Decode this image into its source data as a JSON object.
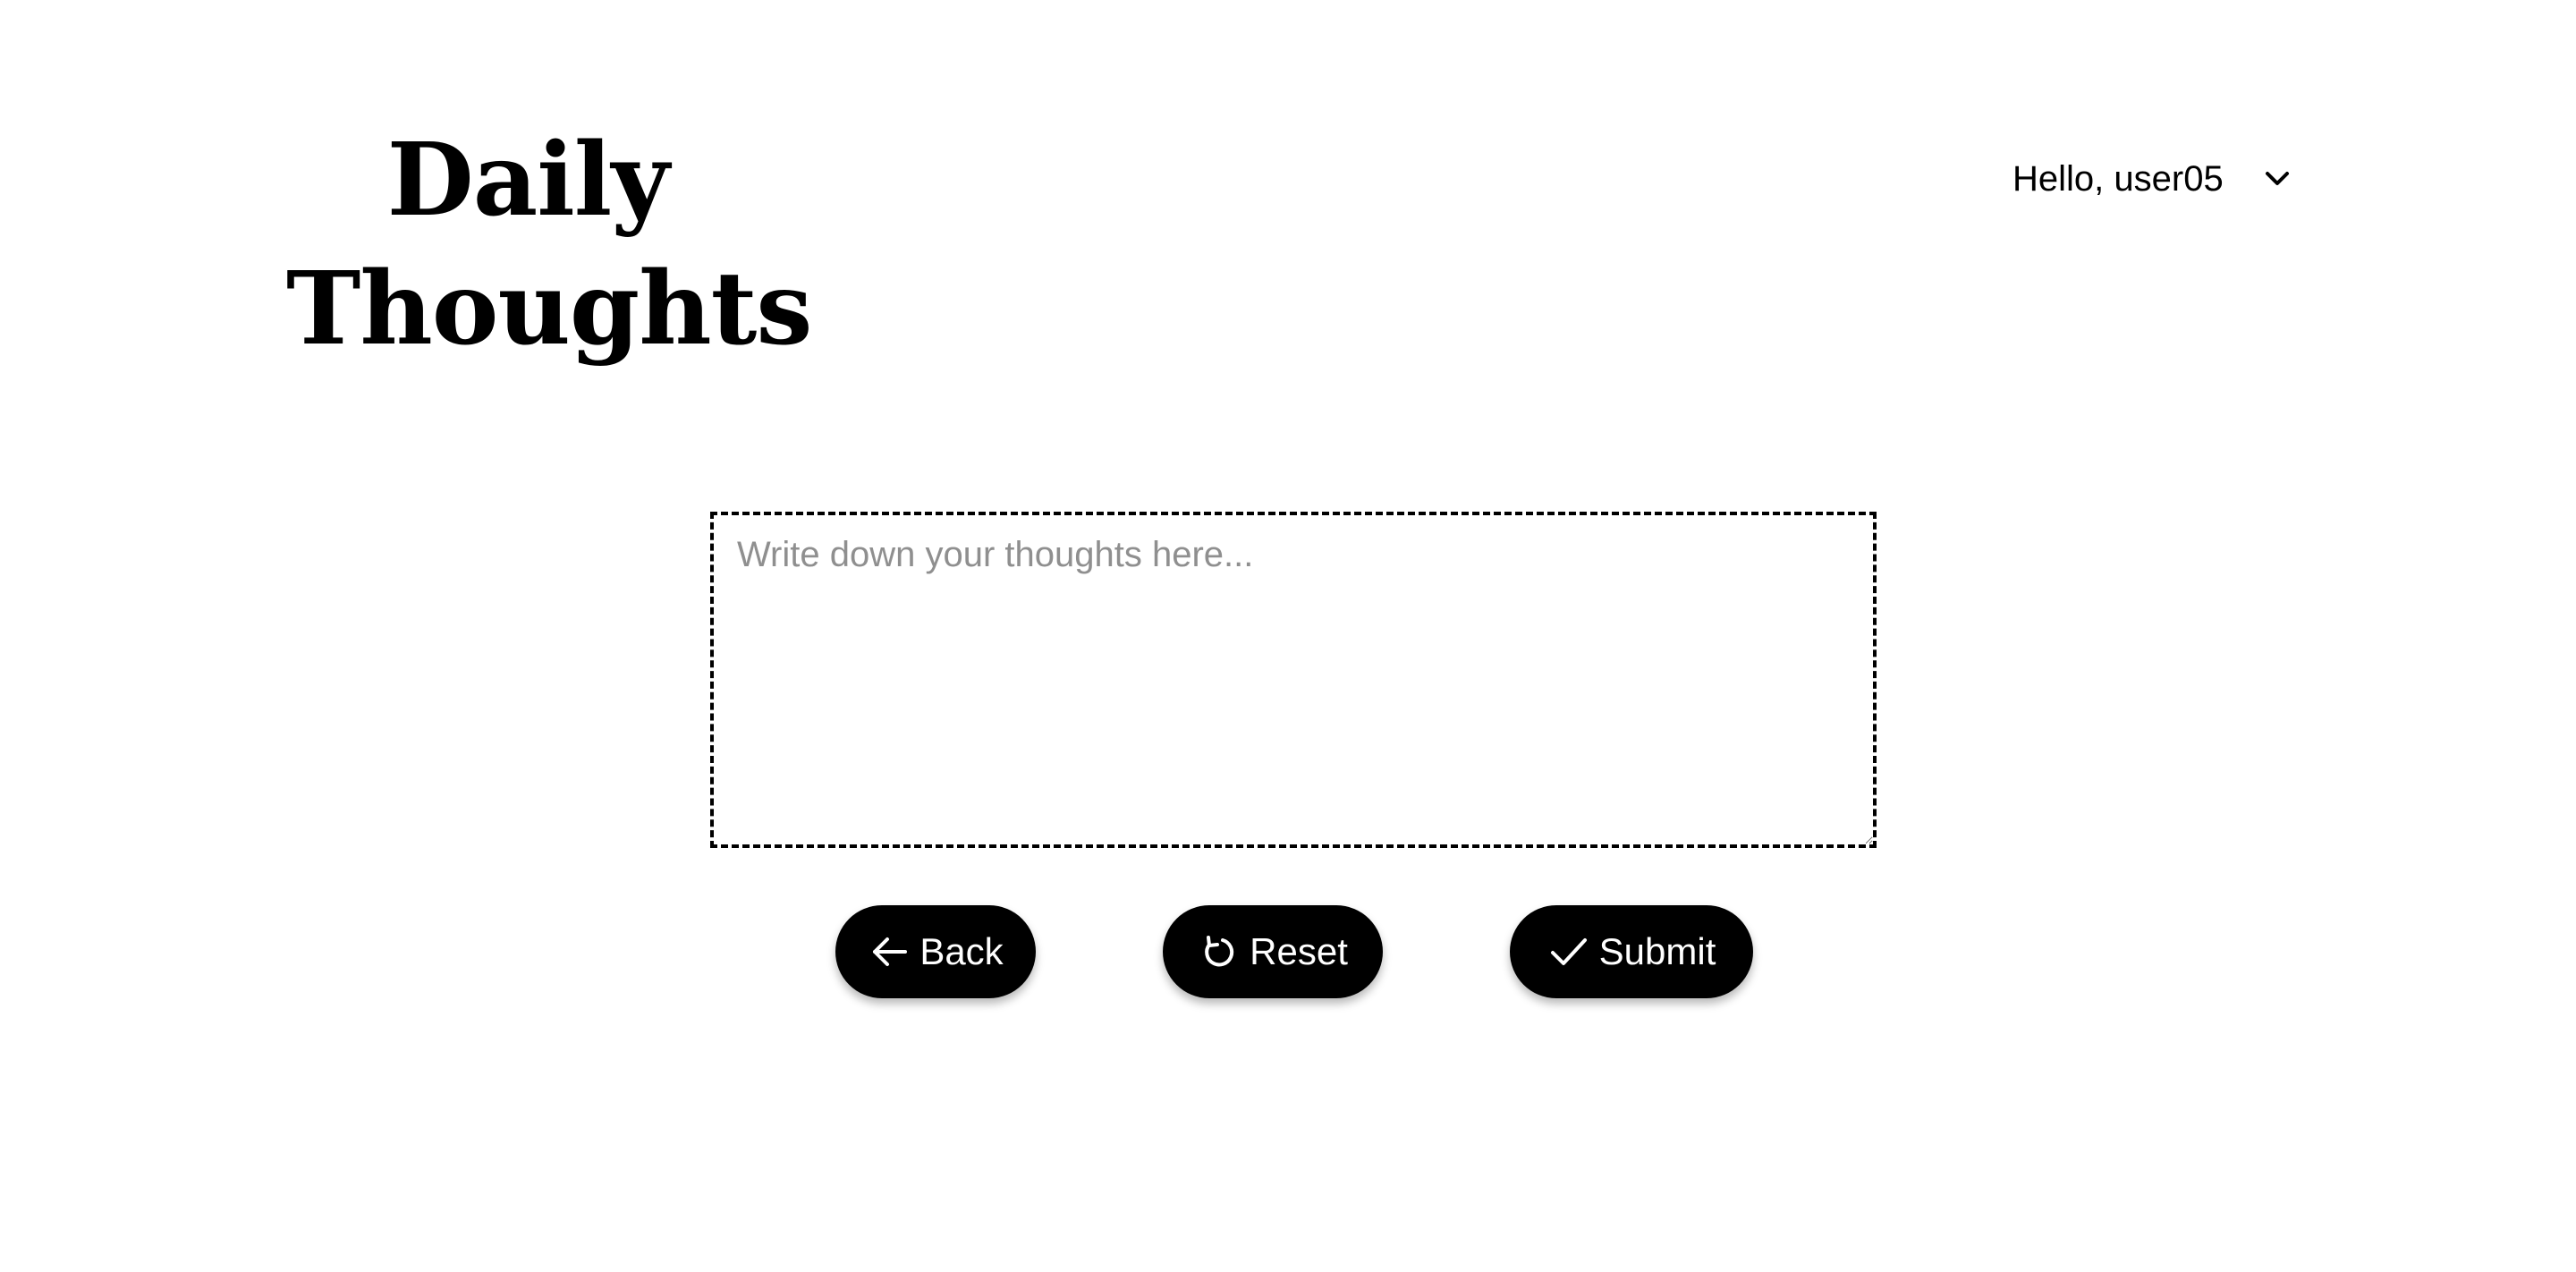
{
  "header": {
    "logo_line1": "Daily",
    "logo_line2": "Thoughts",
    "greeting": "Hello, user05",
    "menu_icon": "chevron-down-icon"
  },
  "editor": {
    "placeholder": "Write down your thoughts here...",
    "value": ""
  },
  "actions": {
    "back_label": "Back",
    "back_icon": "arrow-left-icon",
    "reset_label": "Reset",
    "reset_icon": "refresh-icon",
    "submit_label": "Submit",
    "submit_icon": "check-icon"
  },
  "colors": {
    "background": "#ffffff",
    "primary": "#000000",
    "button_text": "#ffffff",
    "placeholder": "#8f8f8f"
  }
}
